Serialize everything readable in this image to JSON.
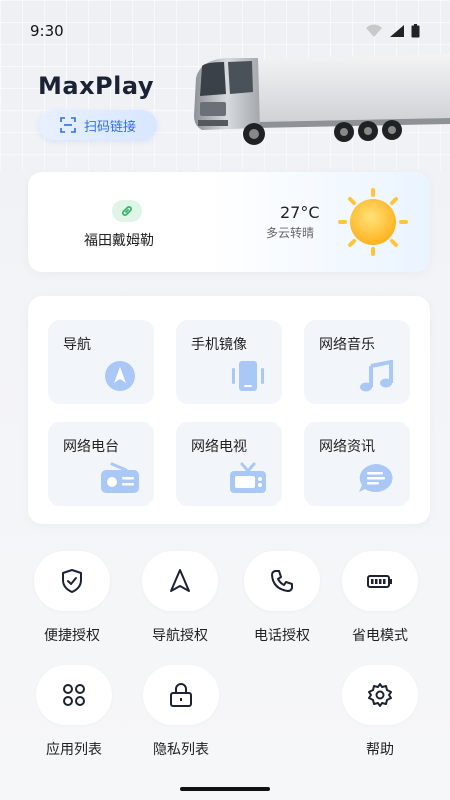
{
  "status_bar": {
    "time": "9:30"
  },
  "header": {
    "brand": "MaxPlay",
    "scan_label": "扫码链接"
  },
  "weather": {
    "device_name": "福田戴姆勒",
    "temperature": "27°C",
    "condition": "多云转晴",
    "icon": "sun-icon"
  },
  "apps": [
    {
      "label": "导航",
      "icon": "navigation-arrow-icon"
    },
    {
      "label": "手机镜像",
      "icon": "phone-mirror-icon"
    },
    {
      "label": "网络音乐",
      "icon": "music-note-icon"
    },
    {
      "label": "网络电台",
      "icon": "radio-icon"
    },
    {
      "label": "网络电视",
      "icon": "tv-icon"
    },
    {
      "label": "网络资讯",
      "icon": "news-bubble-icon"
    }
  ],
  "actions": [
    {
      "label": "便捷授权",
      "icon": "shield-check-icon"
    },
    {
      "label": "导航授权",
      "icon": "navigation-icon"
    },
    {
      "label": "电话授权",
      "icon": "phone-icon"
    },
    {
      "label": "省电模式",
      "icon": "battery-icon"
    },
    {
      "label": "应用列表",
      "icon": "apps-grid-icon"
    },
    {
      "label": "隐私列表",
      "icon": "lock-icon"
    },
    {
      "label": "帮助",
      "icon": "gear-icon"
    }
  ],
  "colors": {
    "accent": "#2f6fe6",
    "tile_bg": "#f2f5fa",
    "icon_blue": "#a9c8f5"
  }
}
